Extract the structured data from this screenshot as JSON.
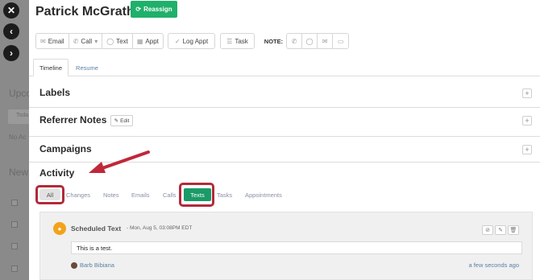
{
  "backdrop": {
    "ghost_texts": [
      "Upco",
      "Toda",
      "No Ac",
      "New"
    ]
  },
  "contact": {
    "name": "Patrick McGrath",
    "reassign_label": "Reassign"
  },
  "toolbar": {
    "email": "Email",
    "call": "Call",
    "text": "Text",
    "appt": "Appt",
    "log_appt": "Log Appt",
    "task": "Task",
    "note_label": "NOTE:"
  },
  "tabs": {
    "timeline": "Timeline",
    "resume": "Resume"
  },
  "sections": {
    "labels": "Labels",
    "referrer_notes": "Referrer Notes",
    "edit": "Edit",
    "campaigns": "Campaigns",
    "activity": "Activity"
  },
  "filters": {
    "all": "All",
    "changes": "Changes",
    "notes": "Notes",
    "emails": "Emails",
    "calls": "Calls",
    "texts": "Texts",
    "tasks": "Tasks",
    "appointments": "Appointments"
  },
  "activity_item": {
    "title": "Scheduled Text",
    "date": "- Mon, Aug 5, 03:08PM EDT",
    "message": "This is a test.",
    "author": "Barb Bibiana",
    "time_ago": "a few seconds ago"
  },
  "colors": {
    "accent_green": "#1fb06a",
    "texts_active": "#1a9a67",
    "highlight_red": "#b22a3a",
    "message_icon": "#f2a31b"
  }
}
